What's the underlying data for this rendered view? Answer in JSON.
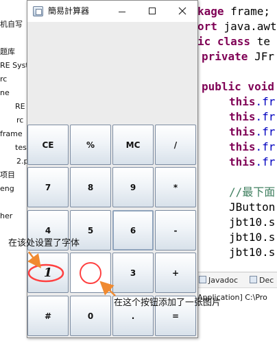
{
  "package_explorer": {
    "rows": [
      "机自写",
      "题库",
      "RE Syst",
      "rc",
      "ne",
      "RE Syst",
      "rc",
      "frame",
      "tes",
      "2.p",
      "项目",
      "eng",
      "her"
    ]
  },
  "editor": {
    "lines": [
      [
        {
          "t": "kage frame;",
          "c": "kw_first"
        }
      ],
      [
        {
          "t": "ort",
          "c": "kw"
        },
        {
          "t": " java.awt",
          "c": "plain"
        }
      ],
      [
        {
          "t": "ic class",
          "c": "kw"
        },
        {
          "t": " te",
          "c": "plain"
        }
      ],
      [
        {
          "t": "private",
          "c": "kw"
        },
        {
          "t": " JFr",
          "c": "plain"
        }
      ],
      [
        {
          "t": "",
          "c": "plain"
        }
      ],
      [
        {
          "t": "public void",
          "c": "kw"
        }
      ],
      [
        {
          "t": "this",
          "c": "kw"
        },
        {
          "t": ".fr",
          "c": "field"
        }
      ],
      [
        {
          "t": "this",
          "c": "kw"
        },
        {
          "t": ".fr",
          "c": "field"
        }
      ],
      [
        {
          "t": "this",
          "c": "kw"
        },
        {
          "t": ".fr",
          "c": "field"
        }
      ],
      [
        {
          "t": "this",
          "c": "kw"
        },
        {
          "t": ".fr",
          "c": "field"
        }
      ],
      [
        {
          "t": "this",
          "c": "kw"
        },
        {
          "t": ".fr",
          "c": "field"
        }
      ],
      [
        {
          "t": "",
          "c": "plain"
        }
      ],
      [
        {
          "t": "//最下面",
          "c": "comment"
        }
      ],
      [
        {
          "t": "JButton",
          "c": "plain"
        }
      ],
      [
        {
          "t": "jbt10.s",
          "c": "plain"
        }
      ],
      [
        {
          "t": "jbt10.s",
          "c": "plain"
        }
      ],
      [
        {
          "t": "jbt10.s",
          "c": "plain"
        }
      ]
    ]
  },
  "views_bar": {
    "tabs": [
      "Javadoc",
      "Dec"
    ]
  },
  "console": {
    "text": "Application] C:\\Pro"
  },
  "calculator": {
    "title": "簡易計算器",
    "display_value": "",
    "keys": [
      [
        "CE",
        "%",
        "MC",
        "/"
      ],
      [
        "7",
        "8",
        "9",
        "*"
      ],
      [
        "4",
        "5",
        "6",
        "-"
      ],
      [
        "1",
        "",
        "3",
        "+"
      ],
      [
        "#",
        "0",
        ".",
        "="
      ]
    ]
  },
  "annotations": {
    "font_note": "在该处设置了字体",
    "image_note": "在这个按钮添加了一张图片"
  },
  "colors": {
    "annotation_red": "#ff4040",
    "annotation_arrow": "#f08a30",
    "keyword": "#7f0055",
    "comment": "#3f7f5f",
    "field": "#0000c0"
  }
}
